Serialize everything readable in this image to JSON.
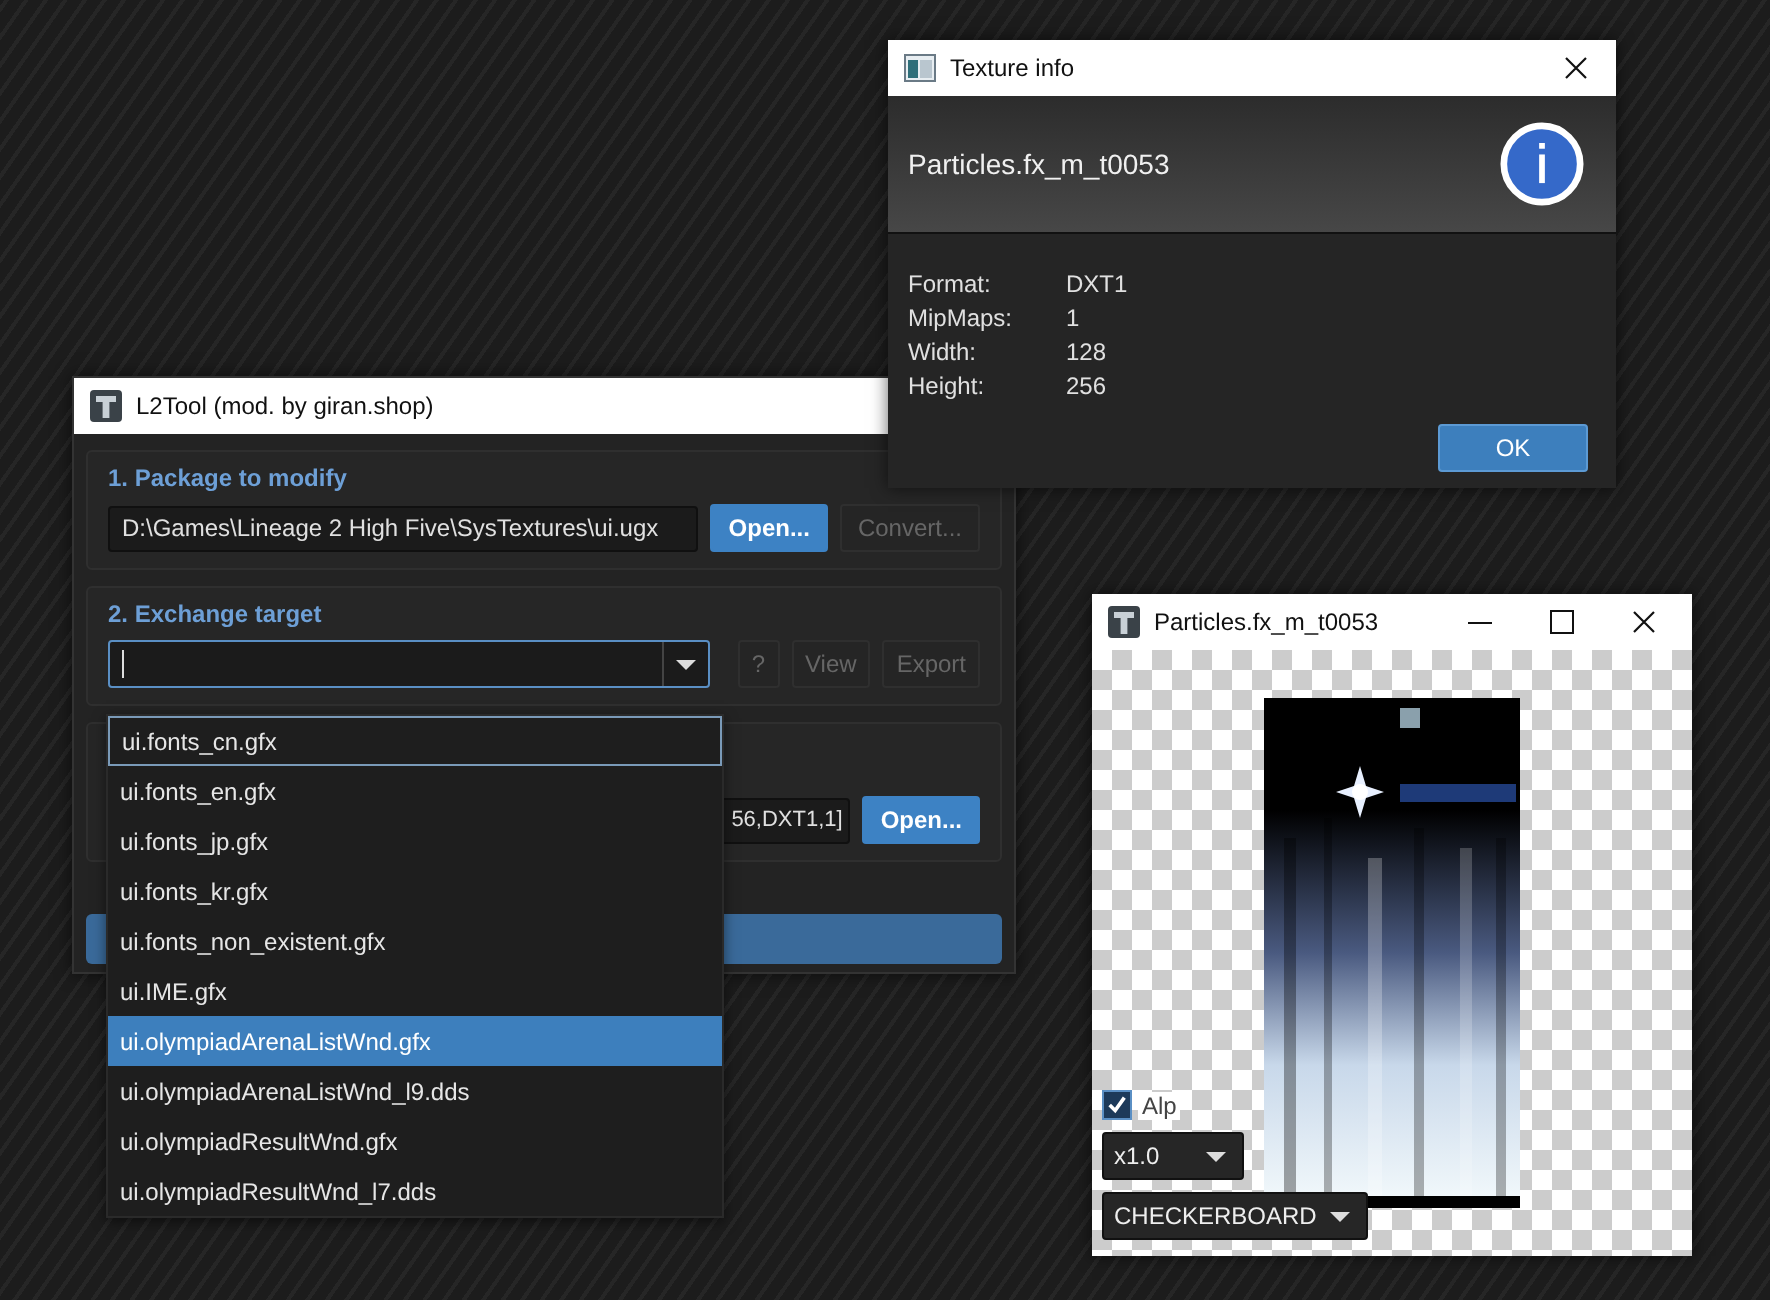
{
  "l2tool_window": {
    "title": "L2Tool (mod. by giran.shop)",
    "package_section": {
      "label": "1. Package to modify",
      "path": "D:\\Games\\Lineage 2 High Five\\SysTextures\\ui.ugx",
      "buttons": [
        {
          "label": "Open...",
          "primary": true,
          "disabled": false
        },
        {
          "label": "Convert...",
          "primary": false,
          "disabled": true
        }
      ]
    },
    "target_section": {
      "label": "2. Exchange target",
      "buttons": [
        {
          "label": "?",
          "primary": false,
          "disabled": true
        },
        {
          "label": "View",
          "primary": false,
          "disabled": true
        },
        {
          "label": "Export",
          "primary": false,
          "disabled": true
        }
      ]
    },
    "source_section": {
      "field_value": "56,DXT1,1]",
      "button": {
        "label": "Open...",
        "primary": true,
        "disabled": false
      }
    },
    "dropdown_items": [
      {
        "label": "ui.fonts_cn.gfx",
        "selected": false,
        "focused": true
      },
      {
        "label": "ui.fonts_en.gfx",
        "selected": false,
        "focused": false
      },
      {
        "label": "ui.fonts_jp.gfx",
        "selected": false,
        "focused": false
      },
      {
        "label": "ui.fonts_kr.gfx",
        "selected": false,
        "focused": false
      },
      {
        "label": "ui.fonts_non_existent.gfx",
        "selected": false,
        "focused": false
      },
      {
        "label": "ui.IME.gfx",
        "selected": false,
        "focused": false
      },
      {
        "label": "ui.olympiadArenaListWnd.gfx",
        "selected": true,
        "focused": false
      },
      {
        "label": "ui.olympiadArenaListWnd_l9.dds",
        "selected": false,
        "focused": false
      },
      {
        "label": "ui.olympiadResultWnd.gfx",
        "selected": false,
        "focused": false
      },
      {
        "label": "ui.olympiadResultWnd_l7.dds",
        "selected": false,
        "focused": false
      }
    ]
  },
  "texture_info_window": {
    "title": "Texture info",
    "heading": "Particles.fx_m_t0053",
    "rows": [
      {
        "label": "Format:",
        "value": "DXT1"
      },
      {
        "label": "MipMaps:",
        "value": "1"
      },
      {
        "label": "Width:",
        "value": "128"
      },
      {
        "label": "Height:",
        "value": "256"
      }
    ],
    "ok_button": "OK"
  },
  "preview_window": {
    "title": "Particles.fx_m_t0053",
    "alpha_checkbox": {
      "label": "Alp",
      "checked": true
    },
    "zoom_combo": "x1.0",
    "background_combo": "CHECKERBOARD"
  }
}
